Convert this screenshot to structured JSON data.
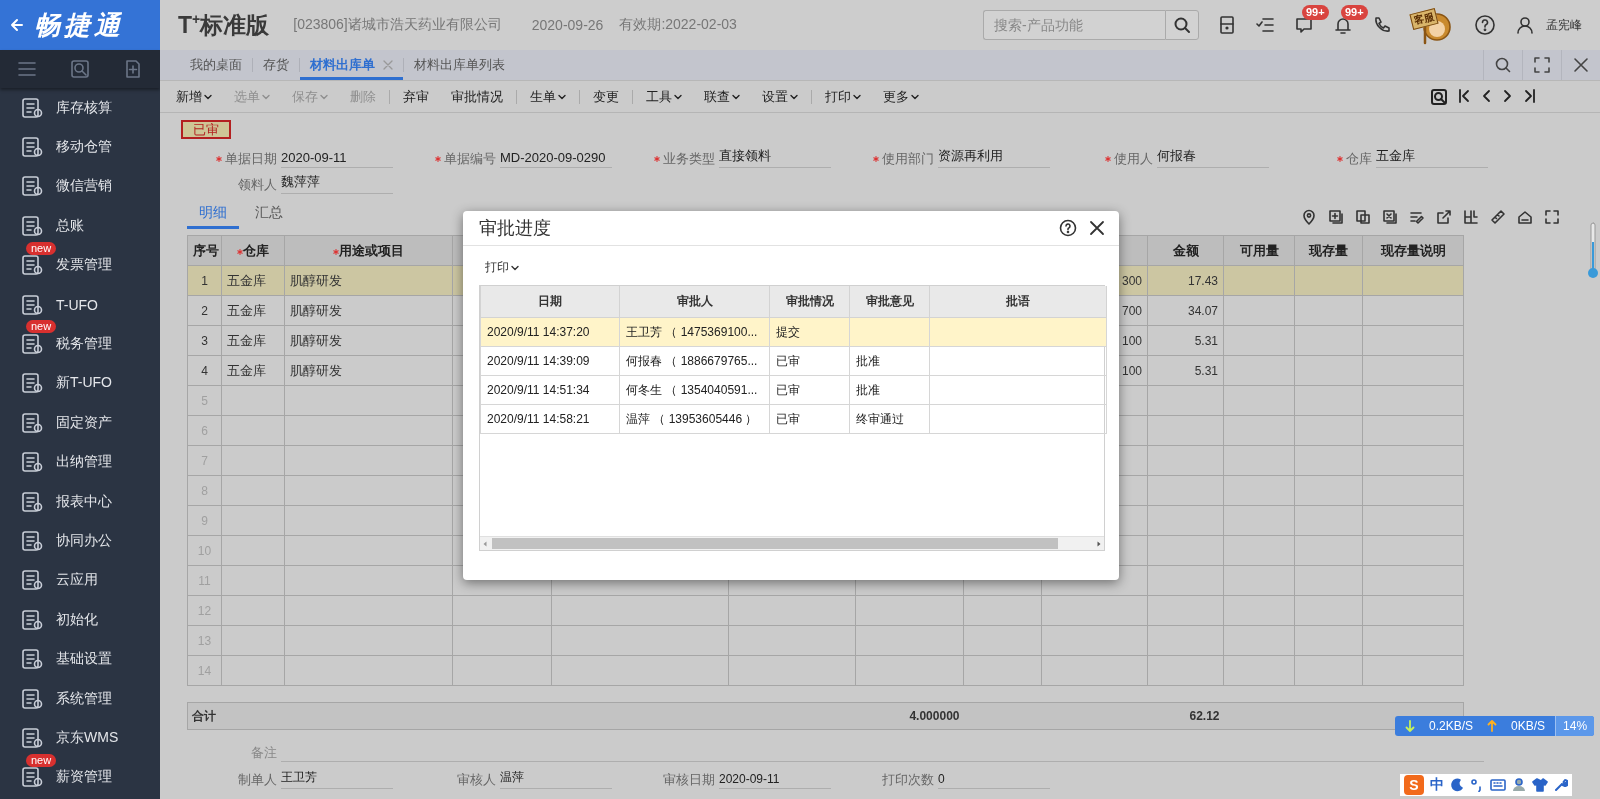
{
  "sidebar": {
    "logo": "畅捷通",
    "items": [
      {
        "label": "库存核算"
      },
      {
        "label": "移动仓管"
      },
      {
        "label": "微信营销"
      },
      {
        "label": "总账"
      },
      {
        "label": "发票管理",
        "badge": "new"
      },
      {
        "label": "T-UFO"
      },
      {
        "label": "税务管理",
        "badge": "new"
      },
      {
        "label": "新T-UFO"
      },
      {
        "label": "固定资产"
      },
      {
        "label": "出纳管理"
      },
      {
        "label": "报表中心"
      },
      {
        "label": "协同办公"
      },
      {
        "label": "云应用"
      },
      {
        "label": "初始化"
      },
      {
        "label": "基础设置"
      },
      {
        "label": "系统管理"
      },
      {
        "label": "京东WMS"
      },
      {
        "label": "薪资管理",
        "badge": "new"
      }
    ]
  },
  "header": {
    "product": "T$^{+}$标准版",
    "company": "[023806]诸城市浩天药业有限公司",
    "date": "2020-09-26",
    "valid_until": "有效期:2022-02-03",
    "search": {
      "placeholder": "搜索-产品功能"
    },
    "messages_badge": "99+",
    "alerts_badge": "99+",
    "service_label": "客服",
    "user_name": "孟宪峰"
  },
  "tabs": [
    {
      "label": "我的桌面",
      "selected": false
    },
    {
      "label": "存货",
      "selected": false
    },
    {
      "label": "材料出库单",
      "selected": true,
      "closable": true
    },
    {
      "label": "材料出库单列表",
      "selected": false
    }
  ],
  "toolbar": [
    {
      "kind": "button",
      "label": "新增",
      "caret": true,
      "disabled": false
    },
    {
      "kind": "button",
      "label": "选单",
      "caret": true,
      "disabled": true
    },
    {
      "kind": "button",
      "label": "保存",
      "caret": true,
      "disabled": true
    },
    {
      "kind": "button",
      "label": "删除",
      "caret": false,
      "disabled": true
    },
    {
      "kind": "separator"
    },
    {
      "kind": "button",
      "label": "弃审",
      "caret": false,
      "disabled": false
    },
    {
      "kind": "button",
      "label": "审批情况",
      "caret": false,
      "disabled": false
    },
    {
      "kind": "separator"
    },
    {
      "kind": "button",
      "label": "生单",
      "caret": true,
      "disabled": false
    },
    {
      "kind": "separator"
    },
    {
      "kind": "button",
      "label": "变更",
      "caret": false,
      "disabled": false
    },
    {
      "kind": "separator"
    },
    {
      "kind": "button",
      "label": "工具",
      "caret": true,
      "disabled": false
    },
    {
      "kind": "button",
      "label": "联查",
      "caret": true,
      "disabled": false
    },
    {
      "kind": "button",
      "label": "设置",
      "caret": true,
      "disabled": false
    },
    {
      "kind": "separator"
    },
    {
      "kind": "button",
      "label": "打印",
      "caret": true,
      "disabled": false
    },
    {
      "kind": "button",
      "label": "更多",
      "caret": true,
      "disabled": false
    }
  ],
  "document": {
    "status": "已审",
    "fields": [
      {
        "label": "单据日期",
        "value": "2020-09-11",
        "required": true
      },
      {
        "label": "单据编号",
        "value": "MD-2020-09-0290",
        "required": true
      },
      {
        "label": "业务类型",
        "value": "直接领料",
        "required": true
      },
      {
        "label": "使用部门",
        "value": "资源再利用",
        "required": true
      },
      {
        "label": "使用人",
        "value": "何报春",
        "required": true
      },
      {
        "label": "仓库",
        "value": "五金库",
        "required": true
      },
      {
        "label": "领料人",
        "value": "魏萍萍",
        "required": false
      }
    ],
    "detail_tabs": [
      {
        "label": "明细",
        "selected": true
      },
      {
        "label": "汇总",
        "selected": false
      }
    ],
    "grid": {
      "columns": [
        {
          "label": "序号",
          "required": false
        },
        {
          "label": "仓库",
          "required": true
        },
        {
          "label": "用途或项目",
          "required": true
        },
        {
          "label": "金额",
          "required": false
        },
        {
          "label": "可用量",
          "required": false
        },
        {
          "label": "现存量",
          "required": false
        },
        {
          "label": "现存量说明",
          "required": false
        }
      ],
      "rows": [
        {
          "number": "1",
          "warehouse": "五金库",
          "purpose": "肌醇研发",
          "column_9": "300",
          "amount": "17.43",
          "selected": true
        },
        {
          "number": "2",
          "warehouse": "五金库",
          "purpose": "肌醇研发",
          "column_9": "700",
          "amount": "34.07",
          "selected": false
        },
        {
          "number": "3",
          "warehouse": "五金库",
          "purpose": "肌醇研发",
          "column_9": "100",
          "amount": "5.31",
          "selected": false
        },
        {
          "number": "4",
          "warehouse": "五金库",
          "purpose": "肌醇研发",
          "column_9": "100",
          "amount": "5.31",
          "selected": false
        },
        {
          "number": "5",
          "selected": false
        },
        {
          "number": "6",
          "selected": false
        },
        {
          "number": "7",
          "selected": false
        },
        {
          "number": "8",
          "selected": false
        },
        {
          "number": "9",
          "selected": false
        },
        {
          "number": "10",
          "selected": false
        },
        {
          "number": "11",
          "selected": false
        },
        {
          "number": "12",
          "selected": false
        },
        {
          "number": "13",
          "selected": false
        },
        {
          "number": "14",
          "selected": false
        }
      ]
    },
    "totals": {
      "label": "合计",
      "quantity": "4.000000",
      "amount": "62.12"
    },
    "footer_fields": [
      {
        "kind": "wide",
        "label": "备注"
      },
      {
        "kind": "field",
        "label": "制单人",
        "value": "王卫芳"
      },
      {
        "kind": "field",
        "label": "审核人",
        "value": "温萍"
      },
      {
        "kind": "field",
        "label": "审核日期",
        "value": "2020-09-11"
      },
      {
        "kind": "field",
        "label": "打印次数",
        "value": "0"
      }
    ]
  },
  "dialog": {
    "title": "审批进度",
    "print_button": "打印",
    "columns": [
      "日期",
      "审批人",
      "审批情况",
      "审批意见",
      "批语"
    ],
    "rows": [
      {
        "date": "2020/9/11 14:37:20",
        "approver": "王卫芳 （ 1475369100...",
        "status": "提交",
        "selected": true
      },
      {
        "date": "2020/9/11 14:39:09",
        "approver": "何报春 （ 1886679765...",
        "status": "已审",
        "opinion": "批准",
        "selected": false
      },
      {
        "date": "2020/9/11 14:51:34",
        "approver": "何冬生 （ 1354040591...",
        "status": "已审",
        "opinion": "批准",
        "selected": false
      },
      {
        "date": "2020/9/11 14:58:21",
        "approver": "温萍 （ 13953605446 ）",
        "status": "已审",
        "opinion": "终审通过",
        "selected": false
      }
    ]
  },
  "network_monitor": {
    "download": "0.2KB/S",
    "upload": "0KB/S",
    "cpu": "14%"
  },
  "ime": {
    "logo": "S",
    "mode": "中"
  }
}
